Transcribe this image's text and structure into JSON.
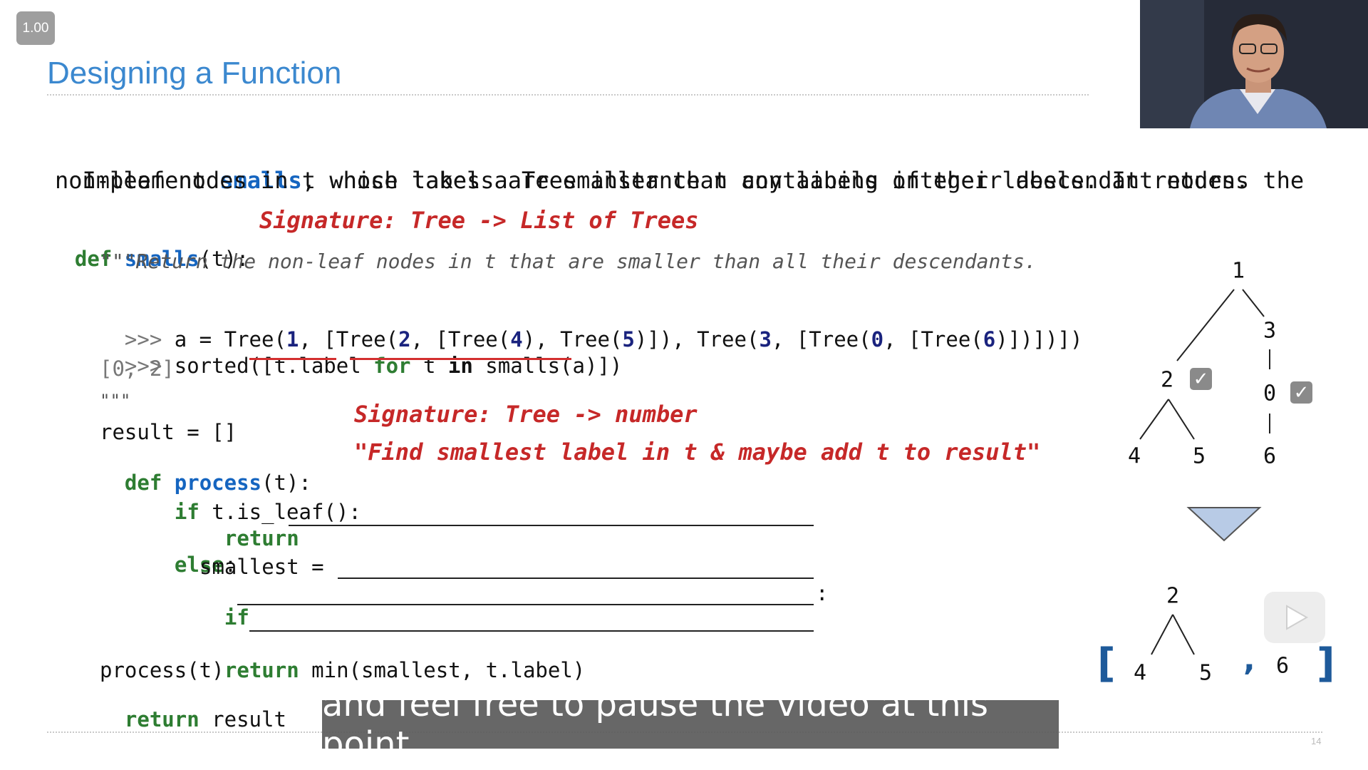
{
  "player": {
    "speed": "1.00",
    "subtitle": "and feel free to pause the video at this point"
  },
  "slide": {
    "title": "Designing a Function",
    "page_number": "14",
    "prompt_line1_pre": "Implement ",
    "prompt_line1_fn": "smalls",
    "prompt_line1_post": ", which takes a Tree instance t containing integer labels. It returns the",
    "prompt_line2": "non-leaf nodes in t whose labels are smaller than any labels of their descendant nodes.",
    "annotation_signature1": "Signature: Tree -> List of Trees",
    "annotation_signature2": "Signature: Tree -> number",
    "annotation_purpose": "\"Find smallest label in t & maybe add t to result\"",
    "code": {
      "def_kw": "def",
      "smalls_name": "smalls",
      "smalls_params": "(t):",
      "docstring": "\"\"\"Return the non-leaf nodes in t that are smaller than all their descendants.",
      "prompt": ">>> ",
      "doctest1_a": "a = Tree(",
      "n1": "1",
      "doctest1_b": ", [Tree(",
      "n2": "2",
      "doctest1_c": ", [Tree(",
      "n4": "4",
      "doctest1_d": "), Tree(",
      "n5": "5",
      "doctest1_e": ")]), Tree(",
      "n3": "3",
      "doctest1_f": ", [Tree(",
      "n0": "0",
      "doctest1_g": ", [Tree(",
      "n6": "6",
      "doctest1_h": ")])])])",
      "doctest2_a": "sorted([",
      "doctest2_label": "t.label",
      "doctest2_for": "for",
      "doctest2_t": " t ",
      "doctest2_in": "in",
      "doctest2_smalls": " smalls(a)",
      "doctest2_end": "])",
      "doctest_output": "[0, 2]",
      "doc_end": "\"\"\"",
      "result_init": "result = []",
      "process_name": "process",
      "process_params": "(t):",
      "if_kw": "if",
      "if_leaf": " t.is_leaf():",
      "return_kw": "return",
      "else_kw": "else",
      "colon": ":",
      "smallest_assign": "smallest =",
      "return_min": " min(smallest, t.label)",
      "call_process": "process(t)",
      "return_result": " result"
    }
  },
  "diagram": {
    "top_tree": [
      "1",
      "3",
      "2",
      "0",
      "4",
      "5",
      "6"
    ],
    "bottom_tree": [
      "2",
      "4",
      "5",
      "6"
    ],
    "bracket_open": "[",
    "bracket_close": "]",
    "comma": ","
  },
  "colors": {
    "title": "#3b88cf",
    "keyword": "#2e7d32",
    "function": "#1565c0",
    "annotation": "#c62828",
    "bracket": "#1e5a9a"
  }
}
